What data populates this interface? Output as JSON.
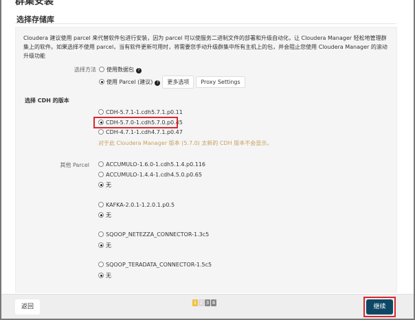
{
  "page_title": "群集安装",
  "section_title": "选择存储库",
  "description": "Cloudera 建议使用 parcel 来代替软件包进行安装，因为 parcel 可以使服务二进制文件的部署和升级自动化，让 Cloudera Manager 轻松地管理群集上的软件。如果选择不使用 parcel，当有软件更新可用时，将需要您手动升级群集中所有主机上的包，并会阻止您使用 Cloudera Manager 的滚动升级功能",
  "method": {
    "label": "选择方法",
    "options": [
      {
        "label": "使用数据包",
        "selected": false
      },
      {
        "label": "使用 Parcel (建议)",
        "selected": true
      }
    ],
    "more_options": "更多选项",
    "proxy_settings": "Proxy Settings"
  },
  "cdh": {
    "title": "选择 CDH 的版本",
    "options": [
      {
        "label": "CDH-5.7.1-1.cdh5.7.1.p0.11",
        "selected": false
      },
      {
        "label": "CDH-5.7.0-1.cdh5.7.0.p0.45",
        "selected": true
      },
      {
        "label": "CDH-4.7.1-1.cdh4.7.1.p0.47",
        "selected": false
      }
    ],
    "note": "对于此 Cloudera Manager 版本 (5.7.0) 太新的 CDH 版本不会显示。"
  },
  "other_parcels": {
    "label": "其他 Parcel",
    "groups": [
      {
        "options": [
          {
            "label": "ACCUMULO-1.6.0-1.cdh5.1.4.p0.116",
            "selected": false
          },
          {
            "label": "ACCUMULO-1.4.4-1.cdh4.5.0.p0.65",
            "selected": false
          },
          {
            "label": "无",
            "selected": true
          }
        ]
      },
      {
        "options": [
          {
            "label": "KAFKA-2.0.1-1.2.0.1.p0.5",
            "selected": false
          },
          {
            "label": "无",
            "selected": true
          }
        ]
      },
      {
        "options": [
          {
            "label": "SQOOP_NETEZZA_CONNECTOR-1.3c5",
            "selected": false
          },
          {
            "label": "无",
            "selected": true
          }
        ]
      },
      {
        "options": [
          {
            "label": "SQOOP_TERADATA_CONNECTOR-1.5c5",
            "selected": false
          },
          {
            "label": "无",
            "selected": true
          }
        ]
      }
    ]
  },
  "footer": {
    "back": "返回",
    "continue": "继续",
    "steps": [
      "1",
      "2",
      "3",
      "4"
    ],
    "current_step": 1,
    "step_colors": [
      "#f0c040",
      "#d8d8d8",
      "#888888",
      "#888888"
    ]
  }
}
